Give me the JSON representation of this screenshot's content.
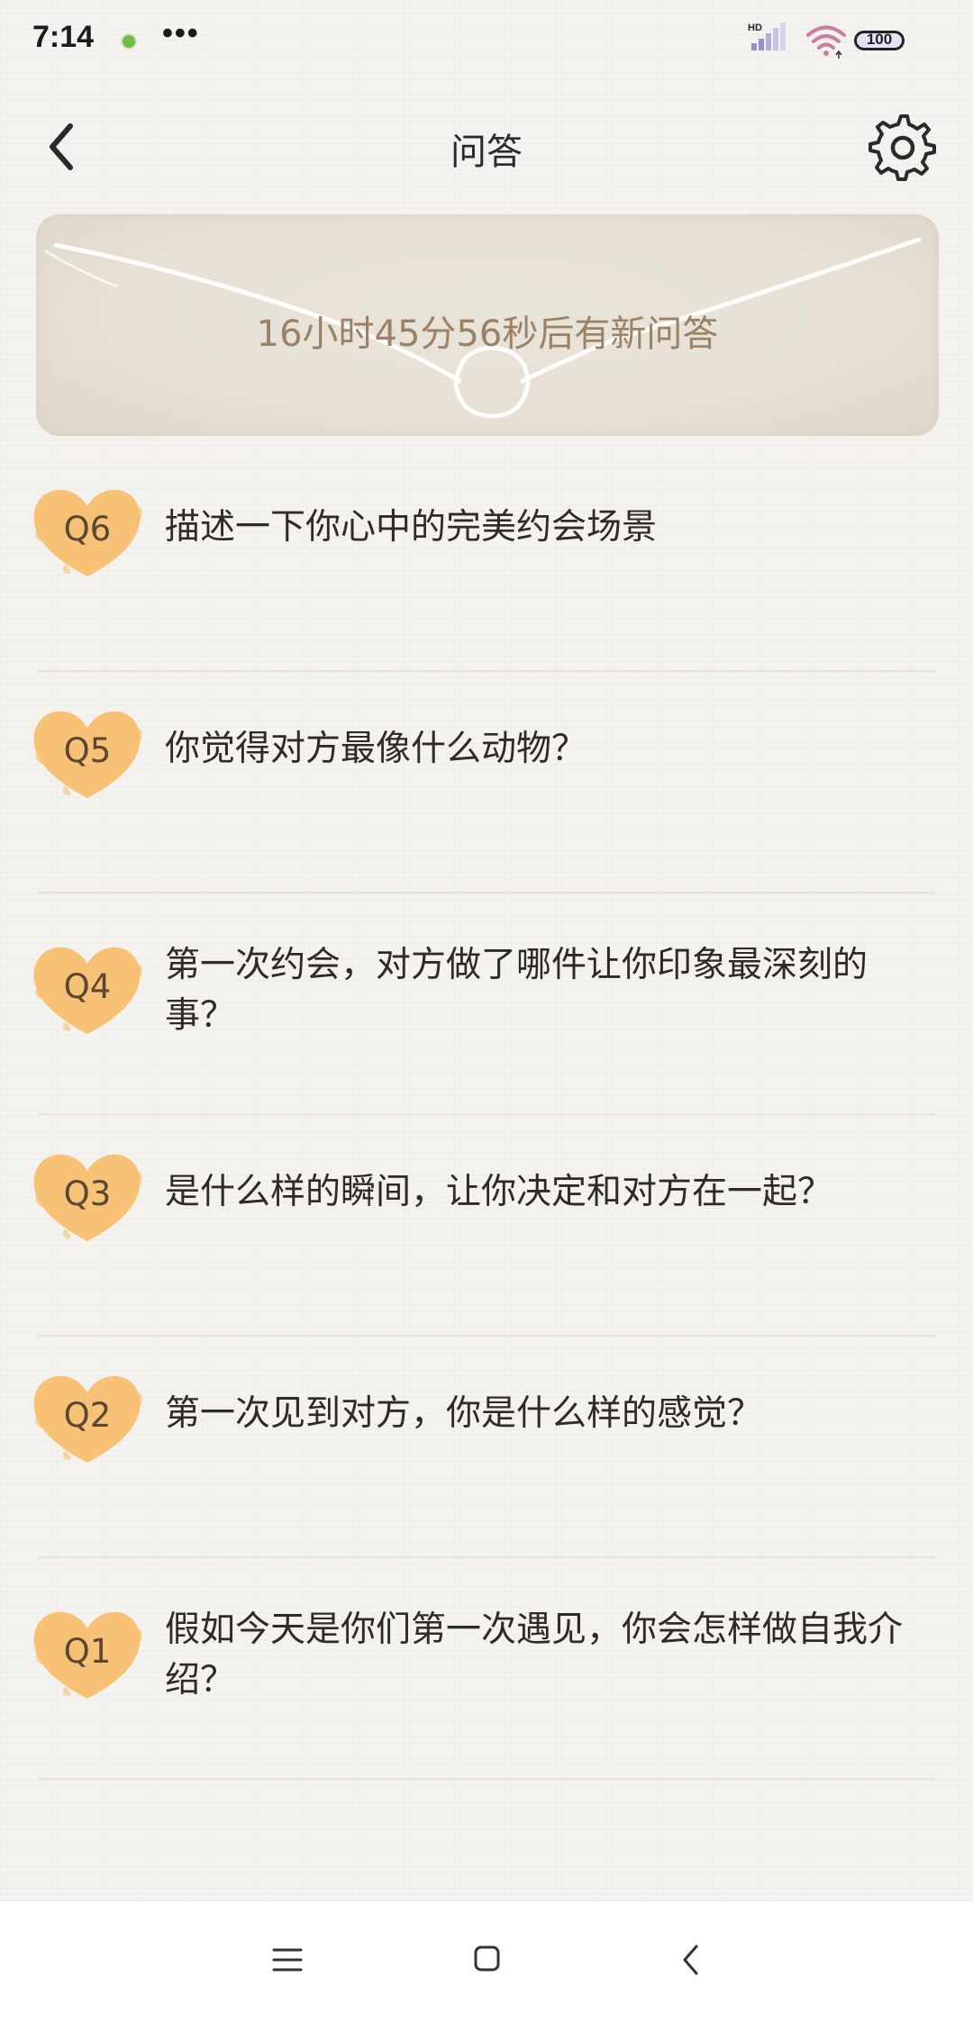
{
  "status_bar": {
    "time": "7:14",
    "more": "•••",
    "network_label": "HD",
    "battery": "100",
    "icons": [
      "notification-dot-icon",
      "signal-icon",
      "wifi-icon",
      "battery-icon"
    ]
  },
  "header": {
    "title": "问答",
    "back_icon": "chevron-left-icon",
    "settings_icon": "gear-icon"
  },
  "banner": {
    "countdown_text": "16小时45分56秒后有新问答"
  },
  "questions": [
    {
      "label": "Q6",
      "text": "描述一下你心中的完美约会场景"
    },
    {
      "label": "Q5",
      "text": "你觉得对方最像什么动物？"
    },
    {
      "label": "Q4",
      "text": "第一次约会，对方做了哪件让你印象最深刻的事？"
    },
    {
      "label": "Q3",
      "text": "是什么样的瞬间，让你决定和对方在一起？"
    },
    {
      "label": "Q2",
      "text": "第一次见到对方，你是什么样的感觉？"
    },
    {
      "label": "Q1",
      "text": "假如今天是你们第一次遇见，你会怎样做自我介绍？"
    }
  ],
  "nav_bar": {
    "icons": [
      "menu-icon",
      "home-icon",
      "back-icon"
    ]
  },
  "colors": {
    "badge": "#f7be6b",
    "banner_text": "#9b8166",
    "background": "#f4f3f0"
  }
}
